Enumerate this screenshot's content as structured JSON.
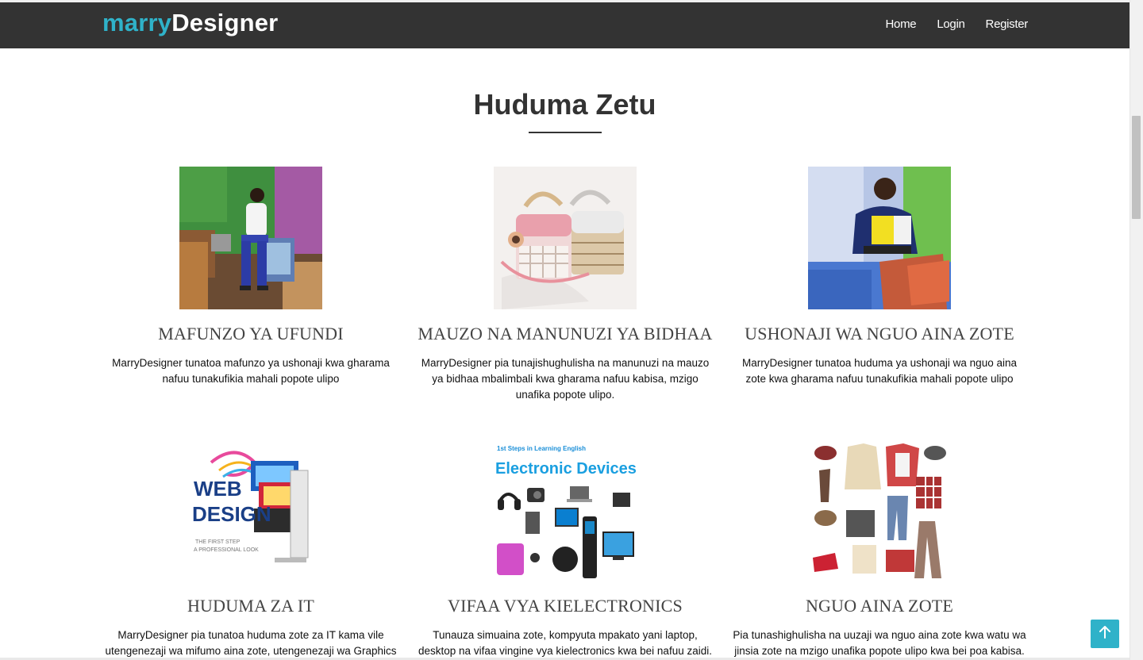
{
  "header": {
    "brand_part1": "marry",
    "brand_part2": "Designer",
    "nav": [
      "Home",
      "Login",
      "Register"
    ]
  },
  "section": {
    "title": "Huduma Zetu"
  },
  "services": [
    {
      "title": "MAFUNZO YA UFUNDI",
      "description": "MarryDesigner tunatoa mafunzo ya ushonaji kwa gharama nafuu tunakufikia mahali popote ulipo",
      "image": "tailoring-workshop-photo"
    },
    {
      "title": "MAUZO NA MANUNUZI YA BIDHAA",
      "description": "MarryDesigner pia tunajishughulisha na manunuzi na mauzo ya bidhaa mbalimbali kwa gharama nafuu kabisa, mzigo unafika popote ulipo.",
      "image": "handbag-photo"
    },
    {
      "title": "USHONAJI WA NGUO AINA ZOTE",
      "description": "MarryDesigner tunatoa huduma ya ushonaji wa nguo aina zote kwa gharama nafuu tunakufikia mahali popote ulipo",
      "image": "fashion-model-photo"
    },
    {
      "title": "HUDUMA ZA IT",
      "description": "MarryDesigner pia tunatoa huduma zote za IT kama vile utengenezaji wa mifumo aina zote, utengenezaji wa Graphics",
      "image": "web-design-graphic",
      "image_text": {
        "line1": "WEB",
        "line2": "DESIGN",
        "line3": "THE FIRST STEP",
        "line4": "A PROFESSIONAL LOOK"
      }
    },
    {
      "title": "VIFAA VYA KIELECTRONICS",
      "description": "Tunauza simuaina zote, kompyuta mpakato yani laptop, desktop na vifaa vingine vya kielectronics kwa bei nafuu zaidi.",
      "image": "electronic-devices-graphic",
      "image_text": {
        "line1": "1st Steps in Learning English",
        "line2": "Electronic Devices"
      }
    },
    {
      "title": "NGUO AINA ZOTE",
      "description": "Pia tunashighulisha na uuzaji wa nguo aina zote kwa watu wa jinsia zote na mzigo unafika popote ulipo kwa bei poa kabisa.",
      "image": "clothing-items-graphic"
    }
  ],
  "back_to_top": {
    "icon": "arrow-up-icon",
    "glyph": "↑"
  },
  "colors": {
    "accent": "#2fb2c9",
    "navbar": "#333333",
    "heading": "#333333"
  }
}
